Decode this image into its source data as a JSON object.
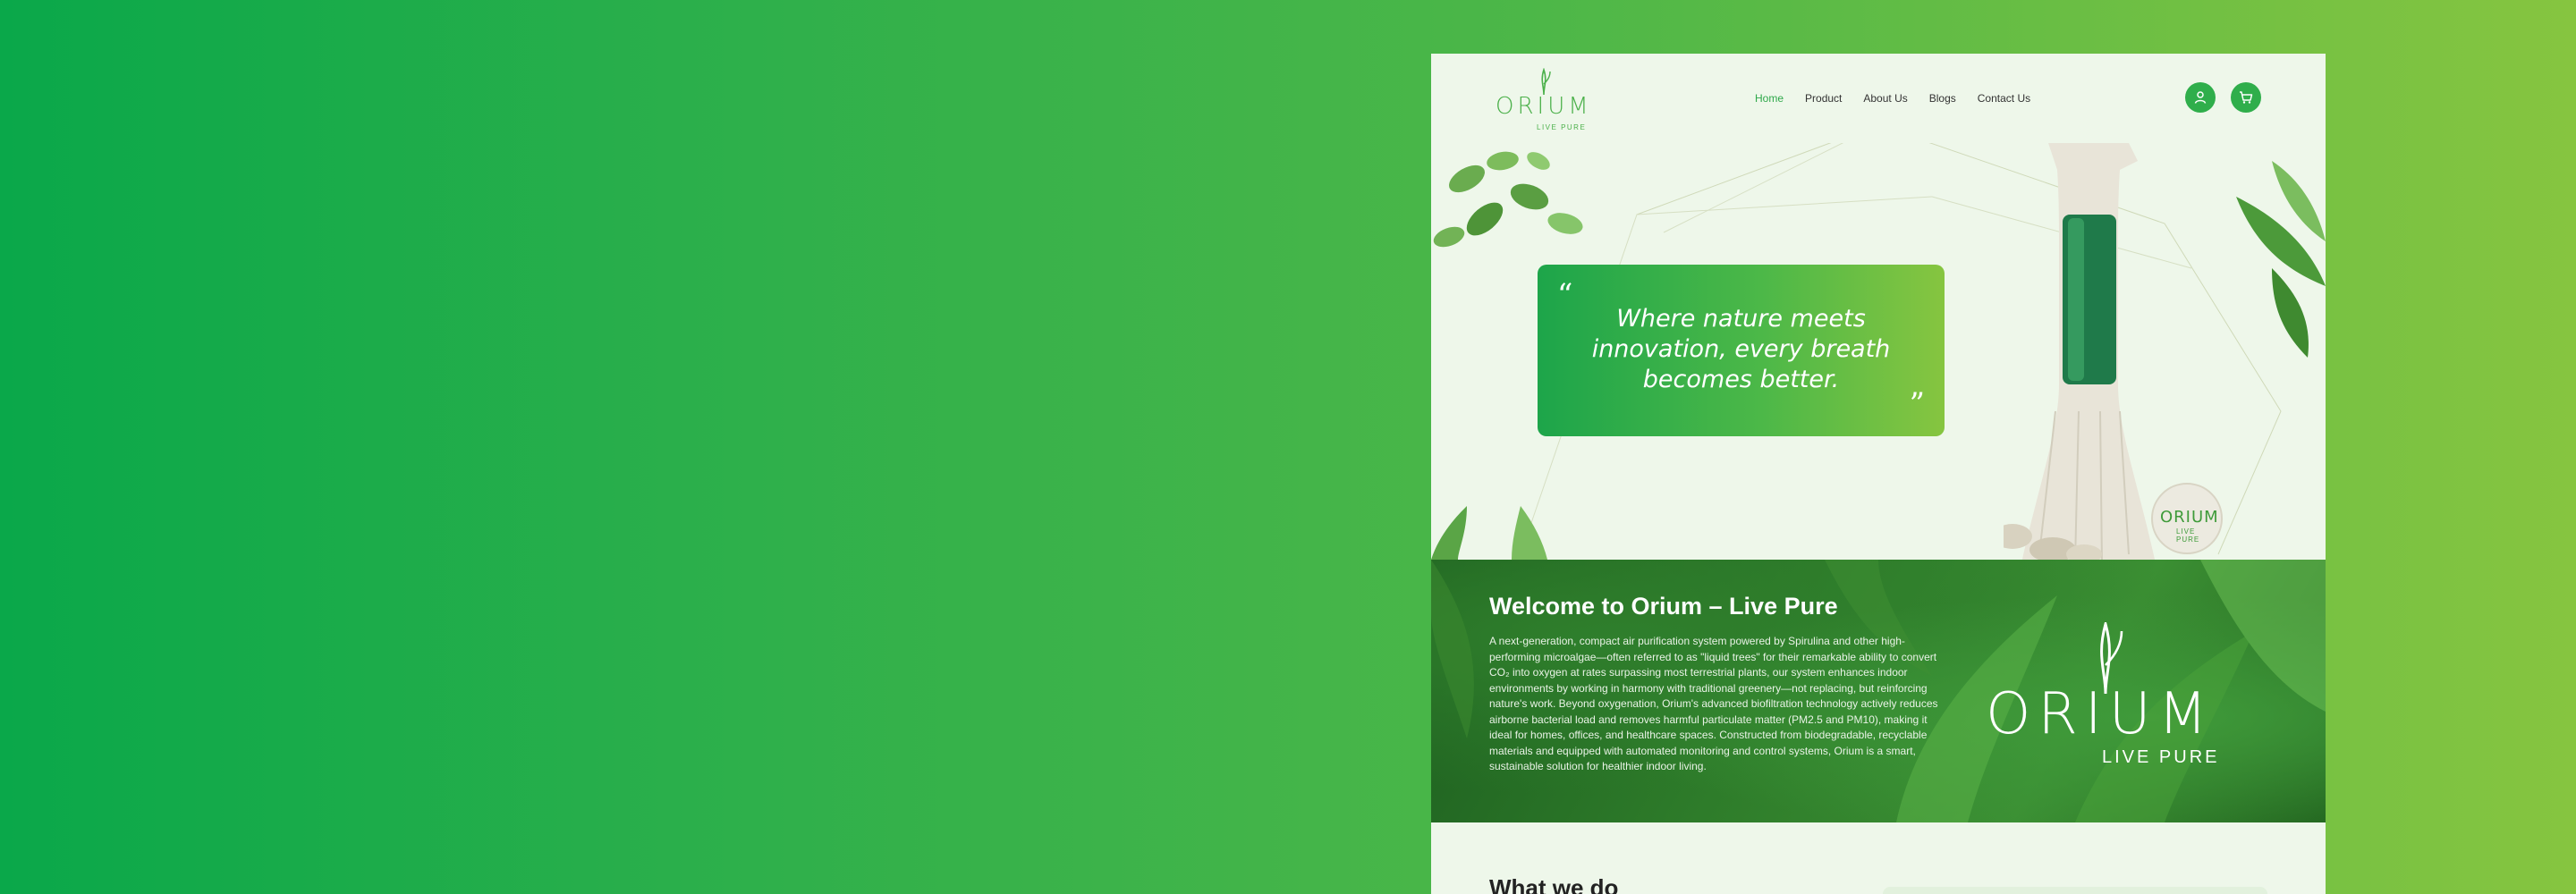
{
  "brand": {
    "logo_word": "ORIUM",
    "logo_sub": "LIVE PURE",
    "accent": "#2fae4b"
  },
  "nav": {
    "items": [
      {
        "label": "Home",
        "active": true
      },
      {
        "label": "Product"
      },
      {
        "label": "About Us"
      },
      {
        "label": "Blogs"
      },
      {
        "label": "Contact Us"
      }
    ]
  },
  "header_icons": [
    "user-icon",
    "cart-icon"
  ],
  "hero": {
    "quote_open": "“",
    "quote_close": "”",
    "quote": "Where nature meets innovation, every breath becomes better."
  },
  "welcome": {
    "title": "Welcome to  Orium – Live Pure",
    "body": "A next-generation, compact air purification system powered by Spirulina and other high-performing microalgae—often referred to as \"liquid trees\" for their remarkable ability to convert CO₂ into oxygen at rates surpassing most terrestrial plants, our system enhances indoor environments by working in harmony with traditional greenery—not replacing, but reinforcing nature's work. Beyond oxygenation, Orium's advanced biofiltration technology actively reduces airborne bacterial load and removes harmful particulate matter (PM2.5 and PM10), making it ideal for homes, offices, and healthcare spaces. Constructed from biodegradable, recyclable materials and equipped with automated monitoring and control systems, Orium is a smart, sustainable solution for healthier indoor living.",
    "logo_word": "ORIUM",
    "logo_sub": "LIVE PURE"
  },
  "next_section": {
    "title": "What we do"
  }
}
